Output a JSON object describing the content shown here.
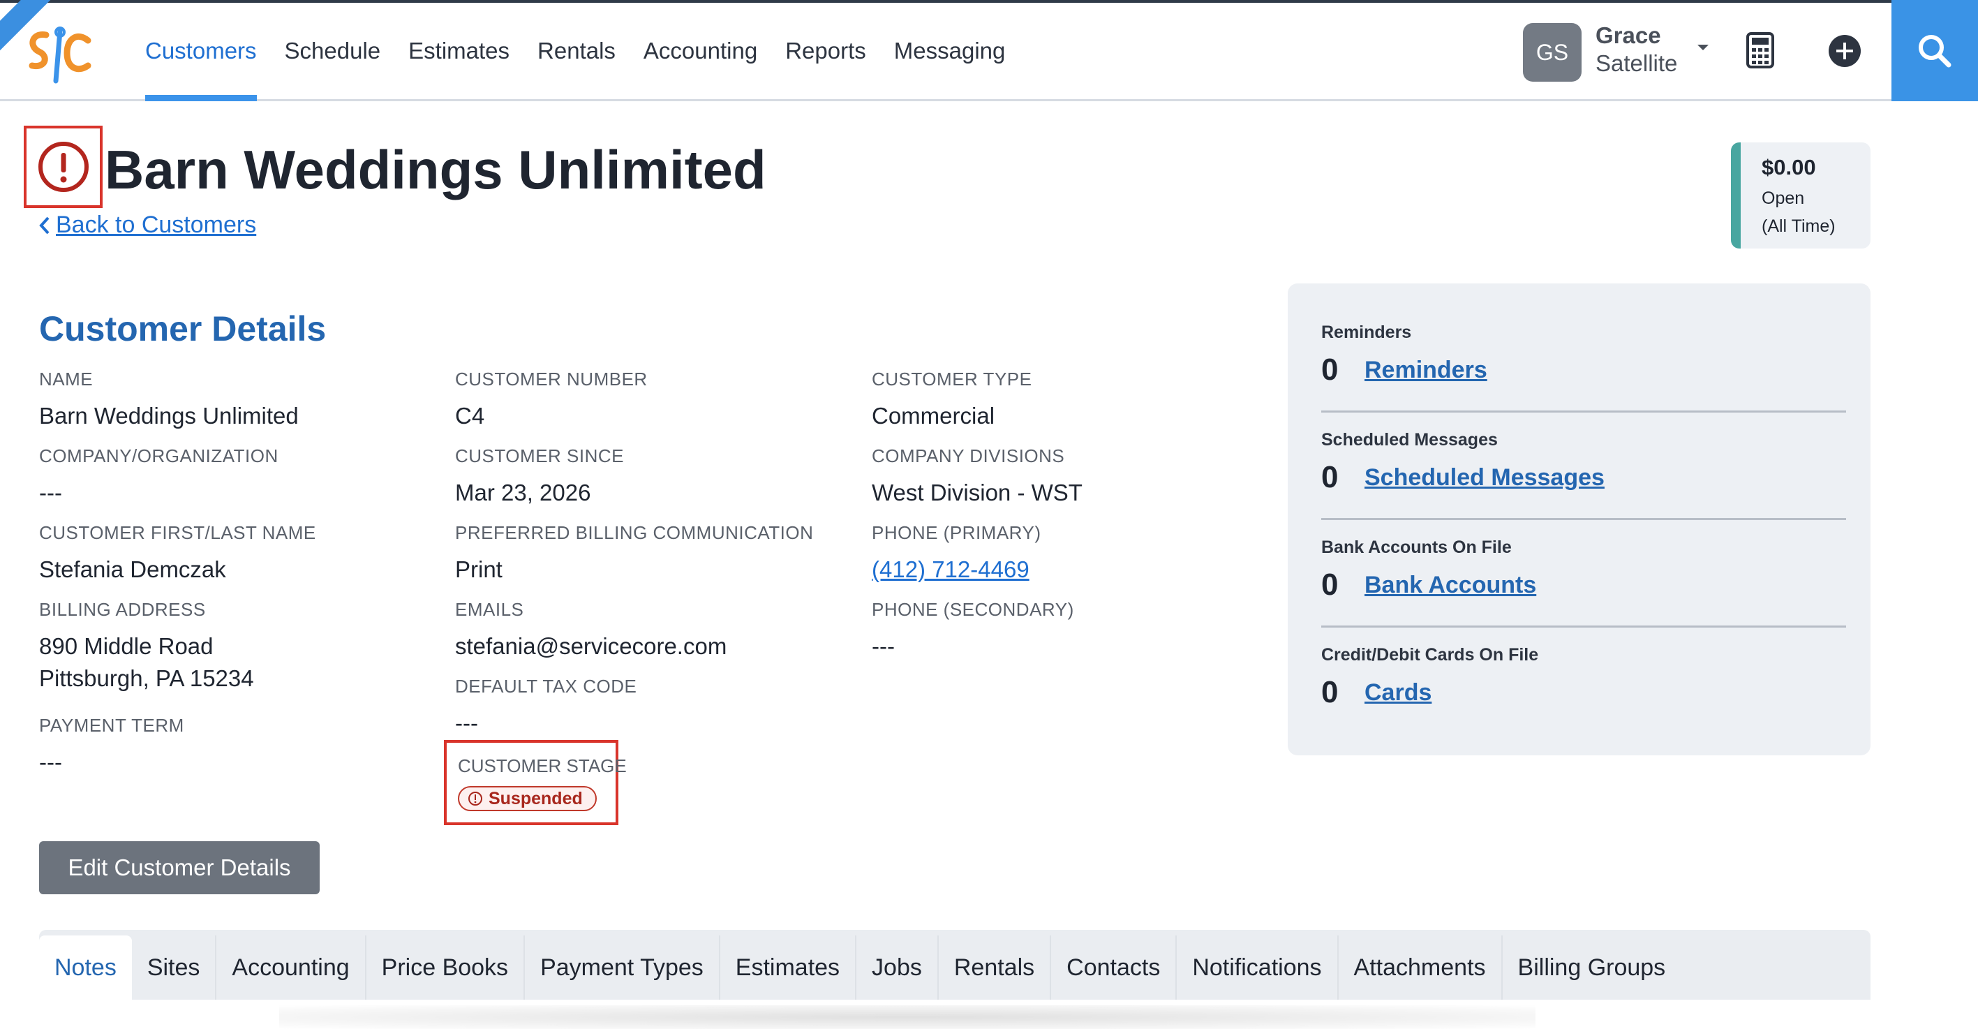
{
  "nav": {
    "items": [
      {
        "label": "Customers",
        "active": true
      },
      {
        "label": "Schedule",
        "active": false
      },
      {
        "label": "Estimates",
        "active": false
      },
      {
        "label": "Rentals",
        "active": false
      },
      {
        "label": "Accounting",
        "active": false
      },
      {
        "label": "Reports",
        "active": false
      },
      {
        "label": "Messaging",
        "active": false
      }
    ],
    "user": {
      "initials": "GS",
      "first_name": "Grace",
      "last_name": "Satellite"
    }
  },
  "header": {
    "title": "Barn Weddings Unlimited",
    "back_link": "Back to Customers"
  },
  "balance": {
    "amount": "$0.00",
    "status": "Open",
    "range": "(All Time)"
  },
  "details": {
    "section_title": "Customer Details",
    "name": {
      "label": "NAME",
      "value": "Barn Weddings Unlimited"
    },
    "company": {
      "label": "COMPANY/ORGANIZATION",
      "value": "---"
    },
    "first_last": {
      "label": "CUSTOMER FIRST/LAST NAME",
      "value": "Stefania Demczak"
    },
    "billing_address": {
      "label": "BILLING ADDRESS",
      "line1": "890 Middle Road",
      "line2": "Pittsburgh, PA 15234"
    },
    "payment_term": {
      "label": "PAYMENT TERM",
      "value": "---"
    },
    "customer_number": {
      "label": "CUSTOMER NUMBER",
      "value": "C4"
    },
    "customer_since": {
      "label": "CUSTOMER SINCE",
      "value": "Mar 23, 2026"
    },
    "billing_comm": {
      "label": "PREFERRED BILLING COMMUNICATION",
      "value": "Print"
    },
    "emails": {
      "label": "EMAILS",
      "value": "stefania@servicecore.com"
    },
    "tax_code": {
      "label": "DEFAULT TAX CODE",
      "value": "---"
    },
    "stage": {
      "label": "CUSTOMER STAGE",
      "value": "Suspended"
    },
    "customer_type": {
      "label": "CUSTOMER TYPE",
      "value": "Commercial"
    },
    "divisions": {
      "label": "COMPANY DIVISIONS",
      "value": "West Division - WST"
    },
    "phone_primary": {
      "label": "PHONE (PRIMARY)",
      "value": "(412) 712-4469"
    },
    "phone_secondary": {
      "label": "PHONE (SECONDARY)",
      "value": "---"
    },
    "edit_button": "Edit Customer Details"
  },
  "summary": {
    "reminders": {
      "label": "Reminders",
      "count": "0",
      "link": "Reminders"
    },
    "scheduled": {
      "label": "Scheduled Messages",
      "count": "0",
      "link": "Scheduled Messages"
    },
    "bank": {
      "label": "Bank Accounts On File",
      "count": "0",
      "link": "Bank Accounts"
    },
    "cards": {
      "label": "Credit/Debit Cards On File",
      "count": "0",
      "link": "Cards"
    }
  },
  "tabs": [
    {
      "label": "Notes",
      "active": true
    },
    {
      "label": "Sites"
    },
    {
      "label": "Accounting"
    },
    {
      "label": "Price Books"
    },
    {
      "label": "Payment Types"
    },
    {
      "label": "Estimates"
    },
    {
      "label": "Jobs"
    },
    {
      "label": "Rentals"
    },
    {
      "label": "Contacts"
    },
    {
      "label": "Notifications"
    },
    {
      "label": "Attachments"
    },
    {
      "label": "Billing Groups"
    }
  ],
  "colors": {
    "accent": "#3b93ea",
    "danger": "#d9342b",
    "link": "#2466b0",
    "balance_bar": "#48a6a0"
  }
}
